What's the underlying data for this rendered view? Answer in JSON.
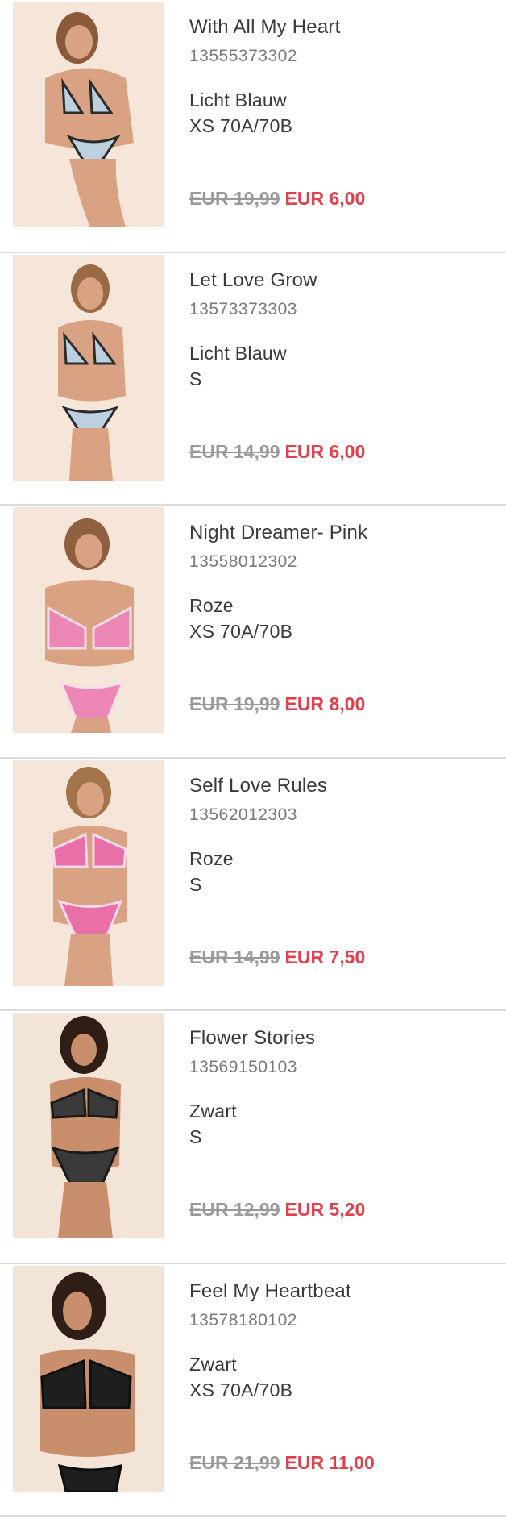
{
  "products": [
    {
      "name": "With All My Heart",
      "sku": "13555373302",
      "color": "Licht Blauw",
      "size": "XS 70A/70B",
      "old_price": "EUR 19,99",
      "new_price": "EUR 6,00",
      "image_icon": "product-photo-light-blue-lingerie",
      "garment_color": "#bcd0e0",
      "trim_color": "#2a2a2a"
    },
    {
      "name": "Let Love Grow",
      "sku": "13573373303",
      "color": "Licht Blauw",
      "size": "S",
      "old_price": "EUR 14,99",
      "new_price": "EUR 6,00",
      "image_icon": "product-photo-light-blue-lingerie",
      "garment_color": "#bcd0e0",
      "trim_color": "#2a2a2a"
    },
    {
      "name": "Night Dreamer- Pink",
      "sku": "13558012302",
      "color": "Roze",
      "size": "XS 70A/70B",
      "old_price": "EUR 19,99",
      "new_price": "EUR 8,00",
      "image_icon": "product-photo-pink-lingerie",
      "garment_color": "#ec86b4",
      "trim_color": "#f6dcea"
    },
    {
      "name": "Self Love Rules",
      "sku": "13562012303",
      "color": "Roze",
      "size": "S",
      "old_price": "EUR 14,99",
      "new_price": "EUR 7,50",
      "image_icon": "product-photo-pink-lingerie",
      "garment_color": "#ea6fa9",
      "trim_color": "#f6dcea"
    },
    {
      "name": "Flower Stories",
      "sku": "13569150103",
      "color": "Zwart",
      "size": "S",
      "old_price": "EUR 12,99",
      "new_price": "EUR 5,20",
      "image_icon": "product-photo-black-lingerie",
      "garment_color": "#3a3a3a",
      "trim_color": "#1a1a1a"
    },
    {
      "name": "Feel My Heartbeat",
      "sku": "13578180102",
      "color": "Zwart",
      "size": "XS 70A/70B",
      "old_price": "EUR 21,99",
      "new_price": "EUR 11,00",
      "image_icon": "product-photo-black-lingerie",
      "garment_color": "#1e1e1e",
      "trim_color": "#0e0e0e"
    }
  ]
}
